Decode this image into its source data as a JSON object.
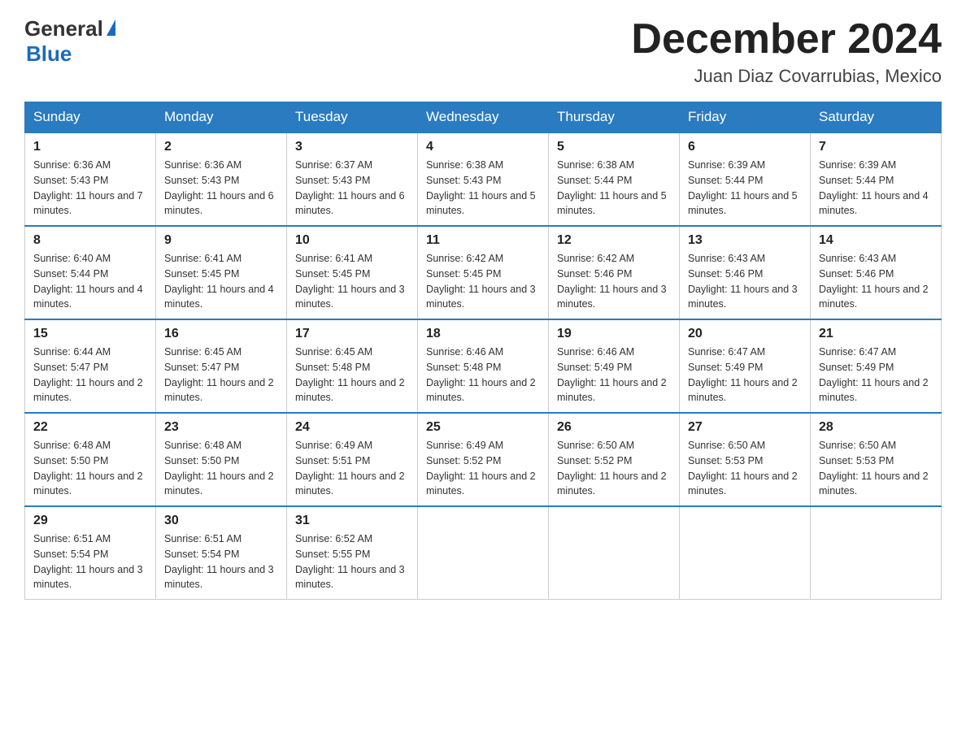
{
  "header": {
    "logo_general": "General",
    "logo_blue": "Blue",
    "month_title": "December 2024",
    "location": "Juan Diaz Covarrubias, Mexico"
  },
  "days_of_week": [
    "Sunday",
    "Monday",
    "Tuesday",
    "Wednesday",
    "Thursday",
    "Friday",
    "Saturday"
  ],
  "weeks": [
    [
      {
        "day": "1",
        "sunrise": "6:36 AM",
        "sunset": "5:43 PM",
        "daylight": "11 hours and 7 minutes."
      },
      {
        "day": "2",
        "sunrise": "6:36 AM",
        "sunset": "5:43 PM",
        "daylight": "11 hours and 6 minutes."
      },
      {
        "day": "3",
        "sunrise": "6:37 AM",
        "sunset": "5:43 PM",
        "daylight": "11 hours and 6 minutes."
      },
      {
        "day": "4",
        "sunrise": "6:38 AM",
        "sunset": "5:43 PM",
        "daylight": "11 hours and 5 minutes."
      },
      {
        "day": "5",
        "sunrise": "6:38 AM",
        "sunset": "5:44 PM",
        "daylight": "11 hours and 5 minutes."
      },
      {
        "day": "6",
        "sunrise": "6:39 AM",
        "sunset": "5:44 PM",
        "daylight": "11 hours and 5 minutes."
      },
      {
        "day": "7",
        "sunrise": "6:39 AM",
        "sunset": "5:44 PM",
        "daylight": "11 hours and 4 minutes."
      }
    ],
    [
      {
        "day": "8",
        "sunrise": "6:40 AM",
        "sunset": "5:44 PM",
        "daylight": "11 hours and 4 minutes."
      },
      {
        "day": "9",
        "sunrise": "6:41 AM",
        "sunset": "5:45 PM",
        "daylight": "11 hours and 4 minutes."
      },
      {
        "day": "10",
        "sunrise": "6:41 AM",
        "sunset": "5:45 PM",
        "daylight": "11 hours and 3 minutes."
      },
      {
        "day": "11",
        "sunrise": "6:42 AM",
        "sunset": "5:45 PM",
        "daylight": "11 hours and 3 minutes."
      },
      {
        "day": "12",
        "sunrise": "6:42 AM",
        "sunset": "5:46 PM",
        "daylight": "11 hours and 3 minutes."
      },
      {
        "day": "13",
        "sunrise": "6:43 AM",
        "sunset": "5:46 PM",
        "daylight": "11 hours and 3 minutes."
      },
      {
        "day": "14",
        "sunrise": "6:43 AM",
        "sunset": "5:46 PM",
        "daylight": "11 hours and 2 minutes."
      }
    ],
    [
      {
        "day": "15",
        "sunrise": "6:44 AM",
        "sunset": "5:47 PM",
        "daylight": "11 hours and 2 minutes."
      },
      {
        "day": "16",
        "sunrise": "6:45 AM",
        "sunset": "5:47 PM",
        "daylight": "11 hours and 2 minutes."
      },
      {
        "day": "17",
        "sunrise": "6:45 AM",
        "sunset": "5:48 PM",
        "daylight": "11 hours and 2 minutes."
      },
      {
        "day": "18",
        "sunrise": "6:46 AM",
        "sunset": "5:48 PM",
        "daylight": "11 hours and 2 minutes."
      },
      {
        "day": "19",
        "sunrise": "6:46 AM",
        "sunset": "5:49 PM",
        "daylight": "11 hours and 2 minutes."
      },
      {
        "day": "20",
        "sunrise": "6:47 AM",
        "sunset": "5:49 PM",
        "daylight": "11 hours and 2 minutes."
      },
      {
        "day": "21",
        "sunrise": "6:47 AM",
        "sunset": "5:49 PM",
        "daylight": "11 hours and 2 minutes."
      }
    ],
    [
      {
        "day": "22",
        "sunrise": "6:48 AM",
        "sunset": "5:50 PM",
        "daylight": "11 hours and 2 minutes."
      },
      {
        "day": "23",
        "sunrise": "6:48 AM",
        "sunset": "5:50 PM",
        "daylight": "11 hours and 2 minutes."
      },
      {
        "day": "24",
        "sunrise": "6:49 AM",
        "sunset": "5:51 PM",
        "daylight": "11 hours and 2 minutes."
      },
      {
        "day": "25",
        "sunrise": "6:49 AM",
        "sunset": "5:52 PM",
        "daylight": "11 hours and 2 minutes."
      },
      {
        "day": "26",
        "sunrise": "6:50 AM",
        "sunset": "5:52 PM",
        "daylight": "11 hours and 2 minutes."
      },
      {
        "day": "27",
        "sunrise": "6:50 AM",
        "sunset": "5:53 PM",
        "daylight": "11 hours and 2 minutes."
      },
      {
        "day": "28",
        "sunrise": "6:50 AM",
        "sunset": "5:53 PM",
        "daylight": "11 hours and 2 minutes."
      }
    ],
    [
      {
        "day": "29",
        "sunrise": "6:51 AM",
        "sunset": "5:54 PM",
        "daylight": "11 hours and 3 minutes."
      },
      {
        "day": "30",
        "sunrise": "6:51 AM",
        "sunset": "5:54 PM",
        "daylight": "11 hours and 3 minutes."
      },
      {
        "day": "31",
        "sunrise": "6:52 AM",
        "sunset": "5:55 PM",
        "daylight": "11 hours and 3 minutes."
      },
      null,
      null,
      null,
      null
    ]
  ]
}
